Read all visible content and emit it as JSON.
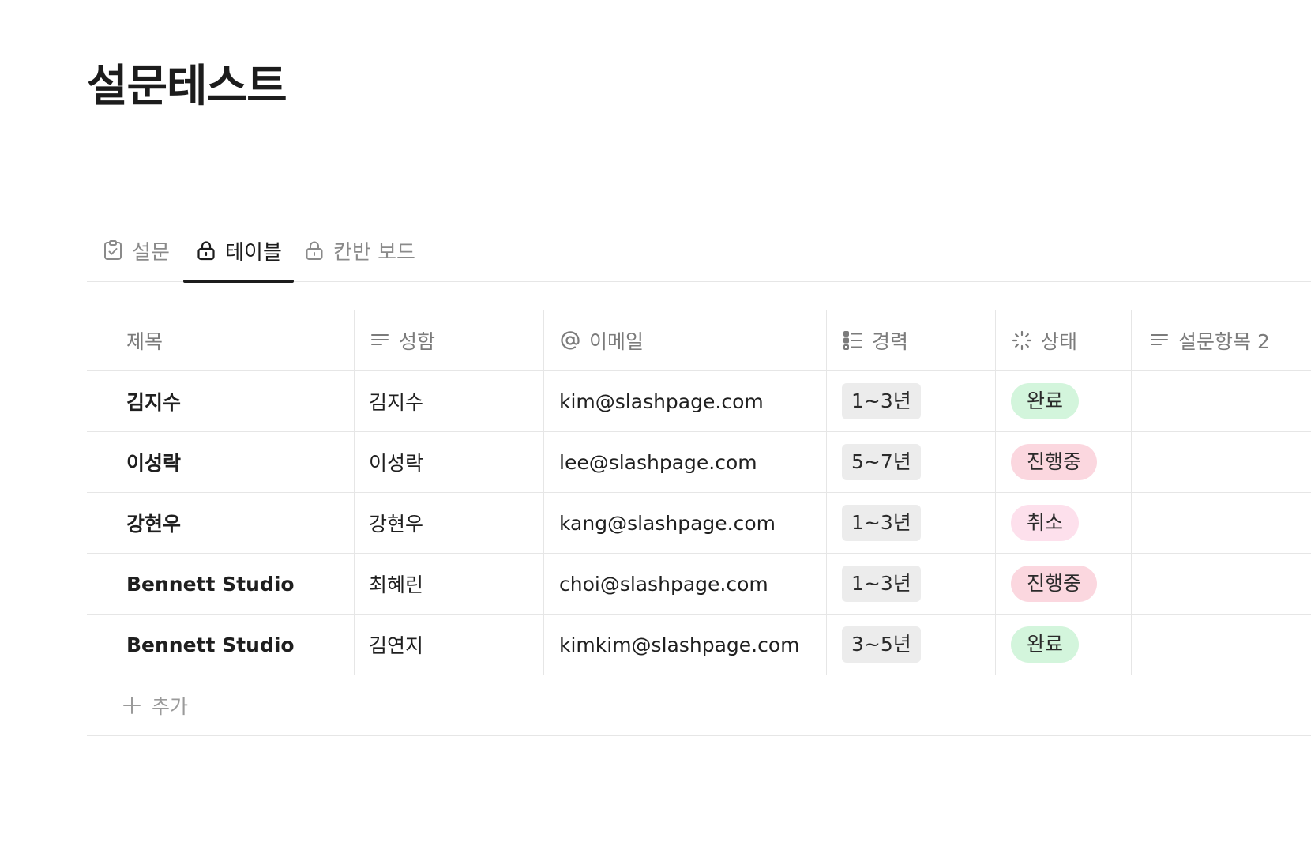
{
  "page": {
    "title": "설문테스트"
  },
  "tabs": [
    {
      "label": "설문",
      "icon": "clipboard-check-icon",
      "active": false
    },
    {
      "label": "테이블",
      "icon": "lock-icon",
      "active": true
    },
    {
      "label": "칸반 보드",
      "icon": "lock-icon",
      "active": false
    }
  ],
  "table": {
    "columns": [
      {
        "label": "제목",
        "icon": null
      },
      {
        "label": "성함",
        "icon": "text-lines-icon"
      },
      {
        "label": "이메일",
        "icon": "at-icon"
      },
      {
        "label": "경력",
        "icon": "select-list-icon"
      },
      {
        "label": "상태",
        "icon": "status-spinner-icon"
      },
      {
        "label": "설문항목 2",
        "icon": "text-lines-icon"
      }
    ],
    "rows": [
      {
        "title": "김지수",
        "name": "김지수",
        "email": "kim@slashpage.com",
        "career": "1~3년",
        "status": "완료"
      },
      {
        "title": "이성락",
        "name": "이성락",
        "email": "lee@slashpage.com",
        "career": "5~7년",
        "status": "진행중"
      },
      {
        "title": "강현우",
        "name": "강현우",
        "email": "kang@slashpage.com",
        "career": "1~3년",
        "status": "취소"
      },
      {
        "title": "Bennett Studio",
        "name": "최혜린",
        "email": "choi@slashpage.com",
        "career": "1~3년",
        "status": "진행중"
      },
      {
        "title": "Bennett Studio",
        "name": "김연지",
        "email": "kimkim@slashpage.com",
        "career": "3~5년",
        "status": "완료"
      }
    ],
    "add_label": "추가"
  },
  "colors": {
    "status_done": "#d3f5dc",
    "status_in_progress": "#fbd7df",
    "status_cancelled": "#fde0ec",
    "tag_bg": "#ececec",
    "border": "#e6e6e6",
    "active_tab": "#1c1c1c"
  }
}
